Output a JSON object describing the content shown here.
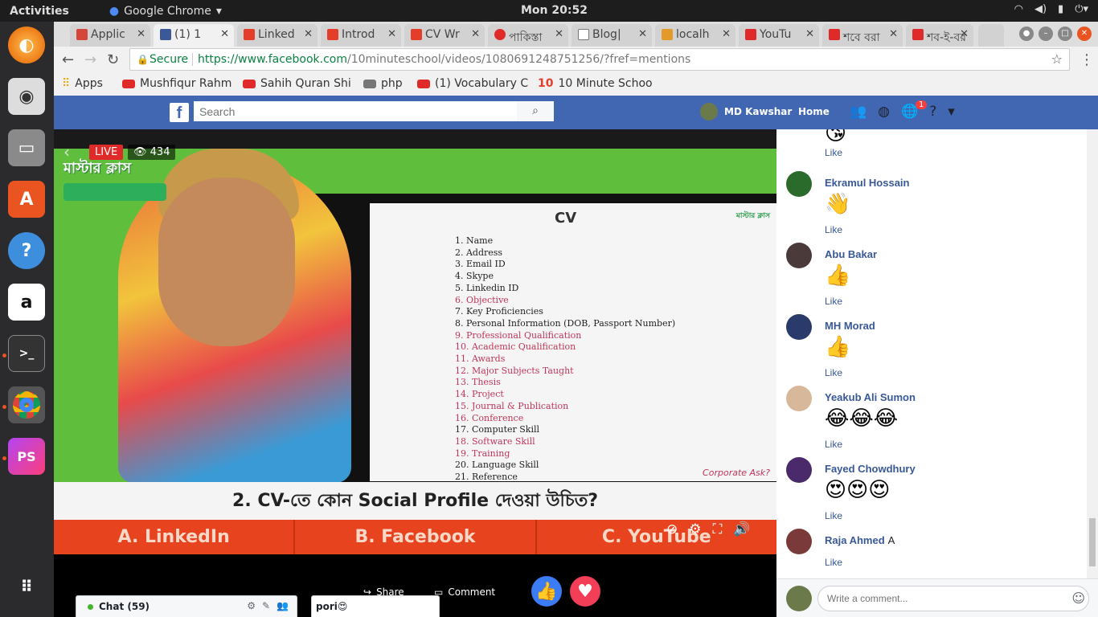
{
  "os": {
    "activities": "Activities",
    "app_name": "Google Chrome",
    "clock": "Mon 20:52"
  },
  "browser": {
    "tabs": [
      {
        "label": "Applic",
        "favicon_color": "#d44638"
      },
      {
        "label": "(1) 1",
        "favicon_color": "#3b5998"
      },
      {
        "label": "Linked",
        "favicon_color": "#e43e2b"
      },
      {
        "label": "Introd",
        "favicon_color": "#e43e2b"
      },
      {
        "label": "CV Wr",
        "favicon_color": "#e43e2b"
      },
      {
        "label": "পাকিস্তা",
        "favicon_color": "#e02a2a"
      },
      {
        "label": "Blog|",
        "favicon_color": "#777777"
      },
      {
        "label": "localh",
        "favicon_color": "#e49a2a"
      },
      {
        "label": "YouTu",
        "favicon_color": "#e02a2a"
      },
      {
        "label": "শবে বরা",
        "favicon_color": "#e02a2a"
      },
      {
        "label": "শব-ই-বর",
        "favicon_color": "#e02a2a"
      }
    ],
    "secure_label": "Secure",
    "url_host": "https://www.facebook.com",
    "url_path": "/10minuteschool/videos/1080691248751256/?fref=mentions",
    "bookmarks": [
      {
        "label": "Apps",
        "color": "#f4a400"
      },
      {
        "label": "Mushfiqur Rahm",
        "color": "#e02a2a"
      },
      {
        "label": "Sahih Quran Shi",
        "color": "#e02a2a"
      },
      {
        "label": "php",
        "color": "#777777"
      },
      {
        "label": "(1) Vocabulary C",
        "color": "#e02a2a"
      },
      {
        "label": "10 Minute Schoo",
        "color": "#e43e2b"
      }
    ]
  },
  "facebook": {
    "logo": "f",
    "search_placeholder": "Search",
    "user_name": "MD Kawshar",
    "home_label": "Home",
    "notif_count": "1"
  },
  "video": {
    "live_label": "LIVE",
    "viewer_count": "434",
    "show_logo": "মাস্টার ক্লাস",
    "slide_title": "CV",
    "slide_brand": "মাস্টার ক্লাস",
    "slide_footer": "Corporate Ask?",
    "slide_items": [
      {
        "n": "1.",
        "t": "Name",
        "hl": false
      },
      {
        "n": "2.",
        "t": "Address",
        "hl": false
      },
      {
        "n": "3.",
        "t": "Email ID",
        "hl": false
      },
      {
        "n": "4.",
        "t": "Skype",
        "hl": false
      },
      {
        "n": "5.",
        "t": "Linkedin ID",
        "hl": false
      },
      {
        "n": "6.",
        "t": "Objective",
        "hl": true
      },
      {
        "n": "7.",
        "t": "Key Proficiencies",
        "hl": false
      },
      {
        "n": "8.",
        "t": "Personal Information (DOB, Passport Number)",
        "hl": false
      },
      {
        "n": "9.",
        "t": "Professional Qualification",
        "hl": true
      },
      {
        "n": "10.",
        "t": "Academic Qualification",
        "hl": true
      },
      {
        "n": "11.",
        "t": "Awards",
        "hl": true
      },
      {
        "n": "12.",
        "t": "Major Subjects Taught",
        "hl": true
      },
      {
        "n": "13.",
        "t": "Thesis",
        "hl": true
      },
      {
        "n": "14.",
        "t": "Project",
        "hl": true
      },
      {
        "n": "15.",
        "t": "Journal & Publication",
        "hl": true
      },
      {
        "n": "16.",
        "t": "Conference",
        "hl": true
      },
      {
        "n": "17.",
        "t": "Computer Skill",
        "hl": false
      },
      {
        "n": "18.",
        "t": "Software Skill",
        "hl": true
      },
      {
        "n": "19.",
        "t": "Training",
        "hl": true
      },
      {
        "n": "20.",
        "t": "Language Skill",
        "hl": false
      },
      {
        "n": "21.",
        "t": "Reference",
        "hl": false
      }
    ],
    "question": "2. CV-তে কোন Social Profile দেওয়া উচিত?",
    "answers": [
      "A. LinkedIn",
      "B. Facebook",
      "C. YouTube"
    ]
  },
  "actions": {
    "share_label": "Share",
    "comment_label": "Comment"
  },
  "chat": {
    "label": "Chat (59)",
    "open_chat_name": "pori😍"
  },
  "comments": [
    {
      "name": "",
      "emoji": "😘",
      "like": "Like",
      "text": "",
      "avatar_color": "#ffffff"
    },
    {
      "name": "Ekramul Hossain",
      "emoji": "👋",
      "like": "Like",
      "text": "",
      "avatar_color": "#2a6a2a"
    },
    {
      "name": "Abu Bakar",
      "emoji": "👍",
      "like": "Like",
      "text": "",
      "avatar_color": "#4a3a3a"
    },
    {
      "name": "MH Morad",
      "emoji": "👍",
      "like": "Like",
      "text": "",
      "avatar_color": "#2a3a6a"
    },
    {
      "name": "Yeakub Ali Sumon",
      "emoji": "😂😂😂",
      "like": "Like",
      "text": "",
      "avatar_color": "#d8b89a"
    },
    {
      "name": "Fayed Chowdhury",
      "emoji": "😍😍😍",
      "like": "Like",
      "text": "",
      "avatar_color": "#4a2a6a"
    },
    {
      "name": "Raja Ahmed",
      "emoji": "",
      "like": "Like",
      "text": "A",
      "avatar_color": "#7a3a3a"
    }
  ],
  "write_comment_placeholder": "Write a comment..."
}
